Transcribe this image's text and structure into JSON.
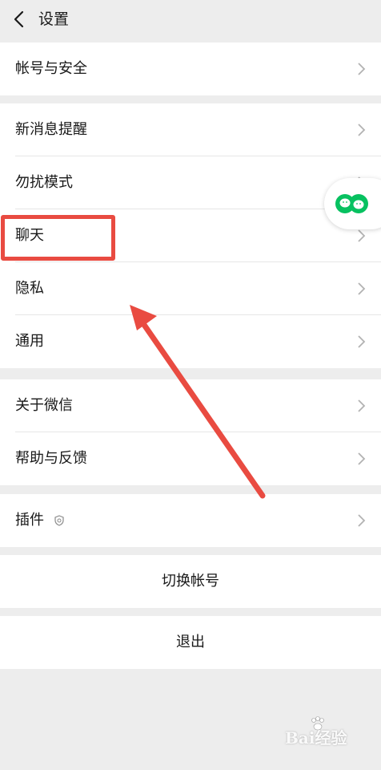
{
  "header": {
    "title": "设置"
  },
  "groups": {
    "account": {
      "items": [
        {
          "label": "帐号与安全"
        }
      ]
    },
    "notify": {
      "items": [
        {
          "label": "新消息提醒"
        },
        {
          "label": "勿扰模式"
        },
        {
          "label": "聊天"
        },
        {
          "label": "隐私"
        },
        {
          "label": "通用"
        }
      ]
    },
    "about": {
      "items": [
        {
          "label": "关于微信"
        },
        {
          "label": "帮助与反馈"
        }
      ]
    },
    "plugins": {
      "items": [
        {
          "label": "插件"
        }
      ]
    }
  },
  "actions": {
    "switch_account": "切换帐号",
    "logout": "退出"
  },
  "watermark": {
    "brand": "Bai",
    "brand_cn": "经验"
  },
  "colors": {
    "highlight": "#e94b41",
    "wechat_green": "#07c160",
    "background": "#ededed"
  }
}
